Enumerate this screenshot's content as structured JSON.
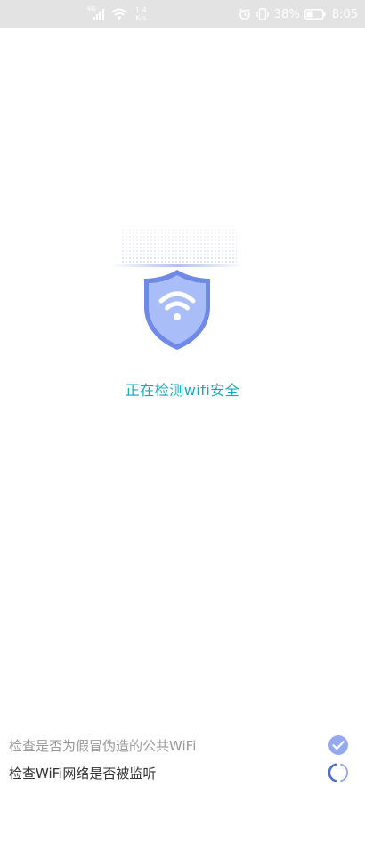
{
  "status_bar": {
    "network_type": "4G",
    "speed_value": "1.4",
    "speed_unit": "K/s",
    "battery_percent": "38%",
    "time": "8:05",
    "icons": [
      "signal-icon",
      "wifi-icon",
      "alarm-icon",
      "vibrate-icon",
      "battery-icon"
    ]
  },
  "scan": {
    "status_text": "正在检测wifi安全",
    "accent_color": "#18a9b5",
    "shield_color": "#6f8ae6"
  },
  "checks": [
    {
      "label": "检查是否为假冒伪造的公共WiFi",
      "state": "done"
    },
    {
      "label": "检查WiFi网络是否被监听",
      "state": "in-progress"
    }
  ]
}
